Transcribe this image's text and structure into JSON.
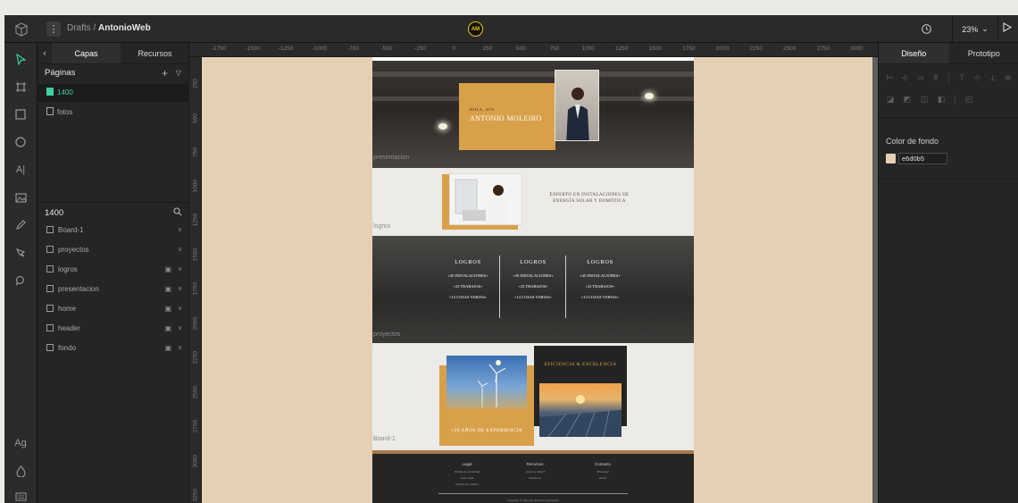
{
  "topbar": {
    "breadcrumb_parent": "Drafts",
    "breadcrumb_sep": " / ",
    "breadcrumb_current": "AntonioWeb",
    "avatar_initials": "AM",
    "zoom": "23%",
    "zoom_chevron": "⌄"
  },
  "toolbar": {
    "text_tool": "A|",
    "font_tool": "Ag"
  },
  "left_panel": {
    "tabs": [
      "Capas",
      "Recursos"
    ],
    "pages_title": "Páginas",
    "pages": [
      "1400",
      "fotos"
    ],
    "layers_title": "1400",
    "layers": [
      "Board-1",
      "proyectos",
      "logros",
      "presentacion",
      "home",
      "header",
      "fondo"
    ]
  },
  "rulers": {
    "top": [
      "-1750",
      "-1500",
      "-1250",
      "-1000",
      "-750",
      "-500",
      "-250",
      "0",
      "250",
      "500",
      "750",
      "1000",
      "1250",
      "1500",
      "1750",
      "2000",
      "2250",
      "2500",
      "2750",
      "3000"
    ],
    "left": [
      "250",
      "500",
      "750",
      "1000",
      "1250",
      "1500",
      "1750",
      "2000",
      "2250",
      "2500",
      "2750",
      "3000",
      "3250"
    ]
  },
  "design": {
    "section_labels": {
      "presentacion": "presentacion",
      "logros": "logros",
      "proyectos": "proyectos",
      "board1": "Board-1"
    },
    "header": {
      "greeting": "HOLA, SOY",
      "name": "ANTONIO MOLEIRO"
    },
    "expert_line1": "EXPERTO EN INSTALACIONES DE",
    "expert_line2": "ENERGÍA SOLAR Y DOMÓTICA",
    "stats": [
      {
        "title": "LOGROS",
        "rows": [
          "+45 INSTALACIONES+",
          "+23 TRABAJOS+",
          "+14 COSAS VARIAS+"
        ]
      },
      {
        "title": "LOGROS",
        "rows": [
          "+45 INSTALACIONES+",
          "+23 TRABAJOS+",
          "+14 COSAS VARIAS+"
        ]
      },
      {
        "title": "LOGROS",
        "rows": [
          "+45 INSTALACIONES+",
          "+23 TRABAJOS+",
          "+14 COSAS VARIAS+"
        ]
      }
    ],
    "years": "+20 AÑOS DE EXPERIENCIA",
    "efficiency": "EFICIENCIA & EXCELENCIA",
    "footer": {
      "cols": [
        {
          "title": "Legal",
          "links": [
            "Política de privacidad",
            "Aviso legal",
            "Política de cookies"
          ]
        },
        {
          "title": "Recursos",
          "links": [
            "¿Quieres saber?",
            "Asistencia"
          ]
        },
        {
          "title": "Contacto",
          "links": [
            "WhatsApp",
            "Email"
          ]
        }
      ],
      "copyright": "Copyright © todos los derechos reservados"
    }
  },
  "right_panel": {
    "tabs": [
      "Diseño",
      "Prototipo"
    ],
    "bg_label": "Color de fondo",
    "bg_hex": "e6d0b5"
  },
  "colors": {
    "accent": "#3ed0a3",
    "avatar_ring": "#f3c400",
    "canvas_bg": "#e6d0b5",
    "gold": "#d9a04a"
  },
  "icons": [
    "cube-logo-icon",
    "menu-icon",
    "history-icon",
    "play-icon",
    "move-icon",
    "board-icon",
    "rect-icon",
    "ellipse-icon",
    "text-icon",
    "image-icon",
    "pencil-icon",
    "path-icon",
    "comment-icon",
    "font-icon",
    "color-icon",
    "keyboard-icon",
    "search-icon",
    "plus-icon",
    "chevron-down-icon",
    "lock-icon"
  ]
}
